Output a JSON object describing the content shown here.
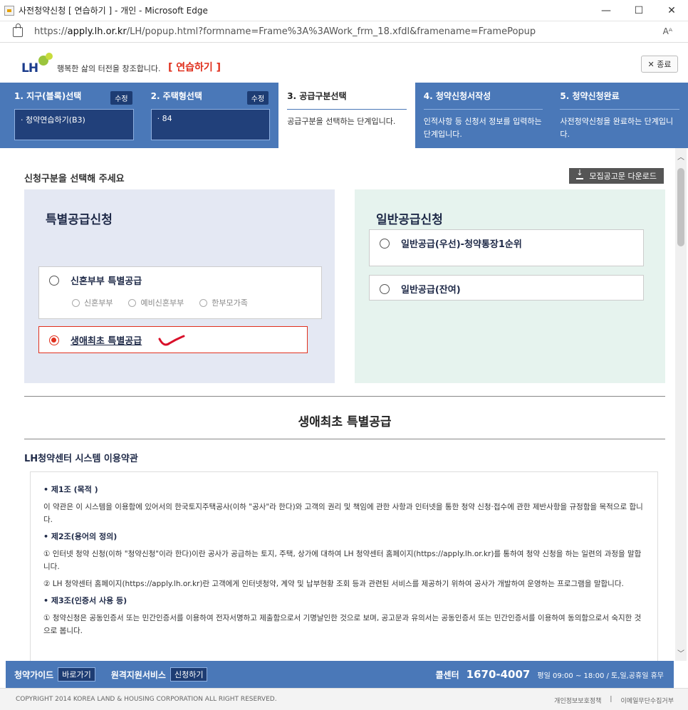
{
  "window": {
    "title": "사전청약신청 [ 연습하기 ] - 개인 - Microsoft Edge",
    "min": "—",
    "max": "☐",
    "close": "✕"
  },
  "address": {
    "url_prefix": "https://",
    "url_host": "apply.lh.or.kr",
    "url_path": "/LH/popup.html?formname=Frame%3A%3AWork_frm_18.xfdl&framename=FramePopup",
    "read_aloud": "Aᴬ"
  },
  "header": {
    "logo_text": "LH",
    "slogan": "행복한 삶의 터전을 창조합니다.",
    "practice": "[ 연습하기 ]",
    "close_button": "✕ 종료"
  },
  "steps": [
    {
      "title": "1. 지구(블록)선택",
      "badge": "수정",
      "value": "· 청약연습하기(B3)"
    },
    {
      "title": "2. 주택형선택",
      "badge": "수정",
      "value": "· 84"
    },
    {
      "title": "3. 공급구분선택",
      "desc": "공급구분을 선택하는 단계입니다."
    },
    {
      "title": "4. 청약신청서작성",
      "desc": "인적사항 등 신청서 정보를 입력하는 단계입니다."
    },
    {
      "title": "5. 청약신청완료",
      "desc": "사전청약신청을 완료하는 단계입니다."
    }
  ],
  "main": {
    "heading": "신청구분을 선택해 주세요",
    "download": "모집공고문 다운로드",
    "special": {
      "title": "특별공급신청",
      "newlywed": "신혼부부 특별공급",
      "subopts": [
        "신혼부부",
        "예비신혼부부",
        "한부모가족"
      ],
      "first_time": "생애최초 특별공급"
    },
    "general": {
      "title": "일반공급신청",
      "priority": "일반공급(우선)-청약통장1순위",
      "remaining": "일반공급(잔여)"
    },
    "selected_title": "생애최초 특별공급",
    "terms_title": "LH청약센터 시스템 이용약관",
    "terms": {
      "art1_title": "• 제1조 (목적 )",
      "art1_body": "이 약관은 이 시스템을 이용함에 있어서의 한국토지주택공사(이하 \"공사\"라 한다)와 고객의 권리 및 책임에 관한 사항과 인터넷을 통한 청약 신청·접수에 관한 제반사항을 규정함을 목적으로 합니다.",
      "art2_title": "• 제2조(용어의 정의)",
      "art2_p1": "① 인터넷 청약 신청(이하 \"청약신청\"이라 한다)이란 공사가 공급하는 토지, 주택, 상가에 대하여 LH 청약센터 홈페이지(https://apply.lh.or.kr)를 통하여 청약 신청을 하는 일련의 과정을 말합니다.",
      "art2_p2": "② LH 청약센터 홈페이지(https://apply.lh.or.kr)란 고객에게 인터넷청약, 계약 및 납부현황 조회 등과 관련된 서비스를 제공하기 위하여 공사가 개발하여 운영하는 프로그램을 말합니다.",
      "art3_title": "• 제3조(인증서 사용 등)",
      "art3_p1": "① 청약신청은 공동인증서 또는 민간인증서를 이용하여 전자서명하고 제출함으로서 기명날인한 것으로 보며, 공고문과 유의서는 공동인증서 또는 민간인증서를 이용하여 동의함으로서 숙지한 것으로 봅니다."
    }
  },
  "footer": {
    "guide_label": "청약가이드",
    "guide_badge": "바로가기",
    "remote_label": "원격지원서비스",
    "remote_badge": "신청하기",
    "call_label": "콜센터",
    "call_number": "1670-4007",
    "hours": "평일 09:00 ~ 18:00 / 토,일,공휴일 휴무"
  },
  "copyright": {
    "text": "COPYRIGHT 2014 KOREA LAND & HOUSING CORPORATION ALL RIGHT RESERVED.",
    "privacy": "개인정보보호정책",
    "email": "이메일무단수집거부"
  }
}
